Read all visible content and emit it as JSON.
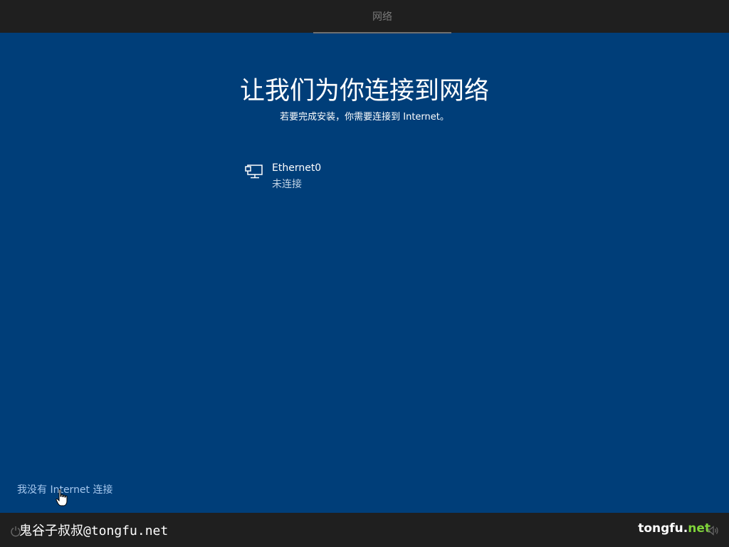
{
  "header": {
    "tab_label": "网络"
  },
  "main": {
    "title": "让我们为你连接到网络",
    "subtitle": "若要完成安装，你需要连接到 Internet。",
    "network": {
      "name": "Ethernet0",
      "status": "未连接",
      "icon": "ethernet-icon"
    },
    "no_internet_link": "我没有 Internet 连接"
  },
  "footer": {
    "watermark_left": "鬼谷子叔叔@tongfu.net",
    "watermark_right_a": "tongfu.",
    "watermark_right_b": "net",
    "icons": [
      "power-icon",
      "volume-icon"
    ]
  },
  "colors": {
    "background": "#003e79",
    "bars": "#1f1f1f",
    "link": "#a6c8ee",
    "watermark_accent": "#7fd33a"
  }
}
